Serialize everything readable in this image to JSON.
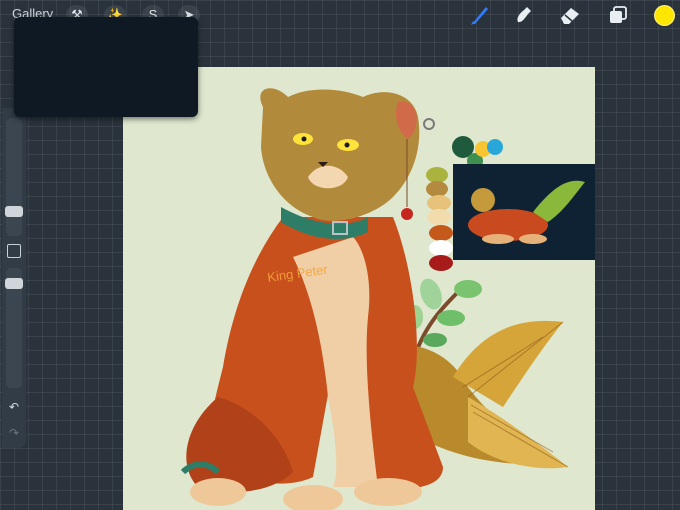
{
  "topbar": {
    "gallery_label": "Gallery",
    "left_tools": [
      {
        "icon": "wrench-icon",
        "glyph": "⚒"
      },
      {
        "icon": "magic-wand-icon",
        "glyph": "✨"
      },
      {
        "icon": "selection-icon",
        "glyph": "S"
      },
      {
        "icon": "transform-arrow-icon",
        "glyph": "➤"
      }
    ],
    "right_tools": [
      "brush-icon",
      "smudge-icon",
      "eraser-icon",
      "layers-icon"
    ],
    "active_color": "#ffe600",
    "accent_color": "#2f7dff"
  },
  "sidebar": {
    "brush_size_level": 0.55,
    "opacity_level": 0.4
  },
  "canvas": {
    "background": "#dfe7cf",
    "signature_text": "King Peter",
    "palette_colors": [
      "#1f5a3c",
      "#3f8f4f",
      "#f7c531",
      "#2aa7d9",
      "#aab33e",
      "#b48a3f",
      "#e6c27a",
      "#f2dcae",
      "#c4591b",
      "#ffffff",
      "#a71b1b"
    ]
  }
}
